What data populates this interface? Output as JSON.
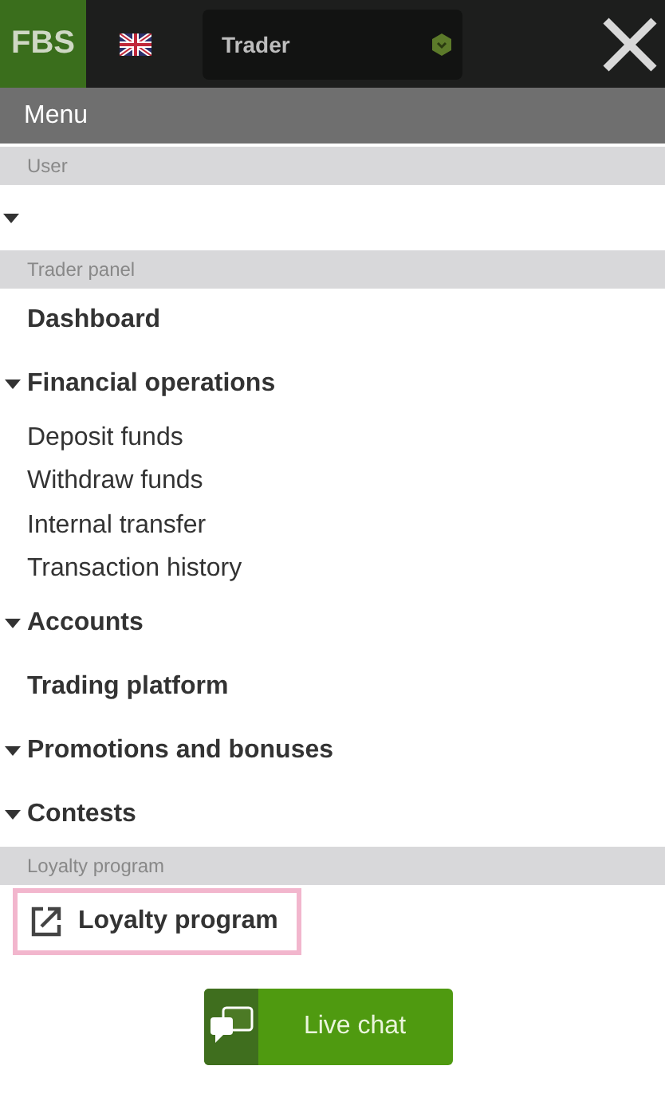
{
  "header": {
    "logo": "FBS",
    "account_selector": {
      "value": "Trader"
    }
  },
  "menu_title": "Menu",
  "sections": [
    {
      "heading": "User",
      "items": [
        {
          "kind": "group",
          "expanded": true
        }
      ]
    },
    {
      "heading": "Trader panel",
      "items": [
        {
          "kind": "link",
          "label": "Dashboard"
        },
        {
          "kind": "group",
          "label": "Financial operations",
          "expanded": true
        },
        {
          "kind": "sub",
          "label": "Deposit funds"
        },
        {
          "kind": "sub",
          "label": "Withdraw funds"
        },
        {
          "kind": "sub",
          "label": "Internal transfer"
        },
        {
          "kind": "sub",
          "label": "Transaction history"
        },
        {
          "kind": "group",
          "label": "Accounts",
          "expanded": true
        },
        {
          "kind": "link",
          "label": "Trading platform"
        },
        {
          "kind": "group",
          "label": "Promotions and bonuses",
          "expanded": true
        },
        {
          "kind": "group",
          "label": "Contests",
          "expanded": true
        }
      ]
    },
    {
      "heading": "Loyalty program",
      "items": [
        {
          "kind": "external",
          "label": "Loyalty program",
          "highlighted": true
        }
      ]
    }
  ],
  "live_chat_button": "Live chat"
}
